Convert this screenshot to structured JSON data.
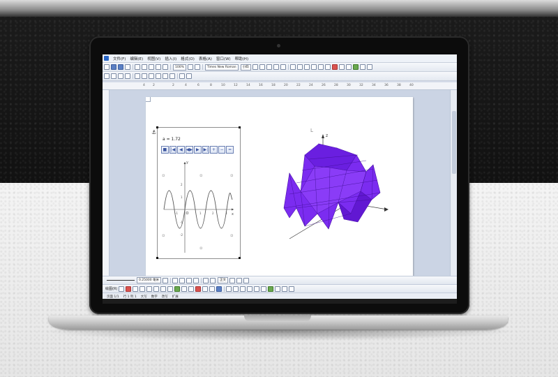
{
  "menu": {
    "items": [
      "文件(F)",
      "编辑(E)",
      "视图(V)",
      "插入(I)",
      "格式(O)",
      "表格(A)",
      "窗口(W)",
      "帮助(H)"
    ]
  },
  "toolbar": {
    "zoom": "100%",
    "font_name": "Times New Roman",
    "font_size": "小四"
  },
  "ruler": {
    "numbers": [
      "4",
      "2",
      "2",
      "4",
      "6",
      "8",
      "10",
      "12",
      "14",
      "16",
      "18",
      "20",
      "22",
      "24",
      "26",
      "28",
      "30",
      "32",
      "34",
      "36",
      "38",
      "40"
    ]
  },
  "graph": {
    "parameter_label": "a = 1.72",
    "anim_buttons": [
      "■",
      "|◀",
      "◀",
      "◀▶",
      "▶",
      "▶|",
      "+",
      "−",
      "="
    ],
    "x_ticks": [
      "-1",
      "1",
      "2",
      "3"
    ],
    "y_ticks": [
      "2",
      "1",
      "-1",
      "-2"
    ],
    "origin": "O",
    "x_axis": "x",
    "y_axis": "y"
  },
  "surface": {
    "color": "#7b2cf0",
    "z_axis": "z"
  },
  "bottom_toolbar": {
    "line_width": "0.25000 毫米",
    "text_mode": "正文",
    "draw_label": "绘图(R)"
  },
  "status": {
    "section": "页面 1/1",
    "position": "行 1 列 1",
    "mode1": "大写",
    "mode2": "数字",
    "mode3": "改写",
    "mode4": "扩展"
  }
}
